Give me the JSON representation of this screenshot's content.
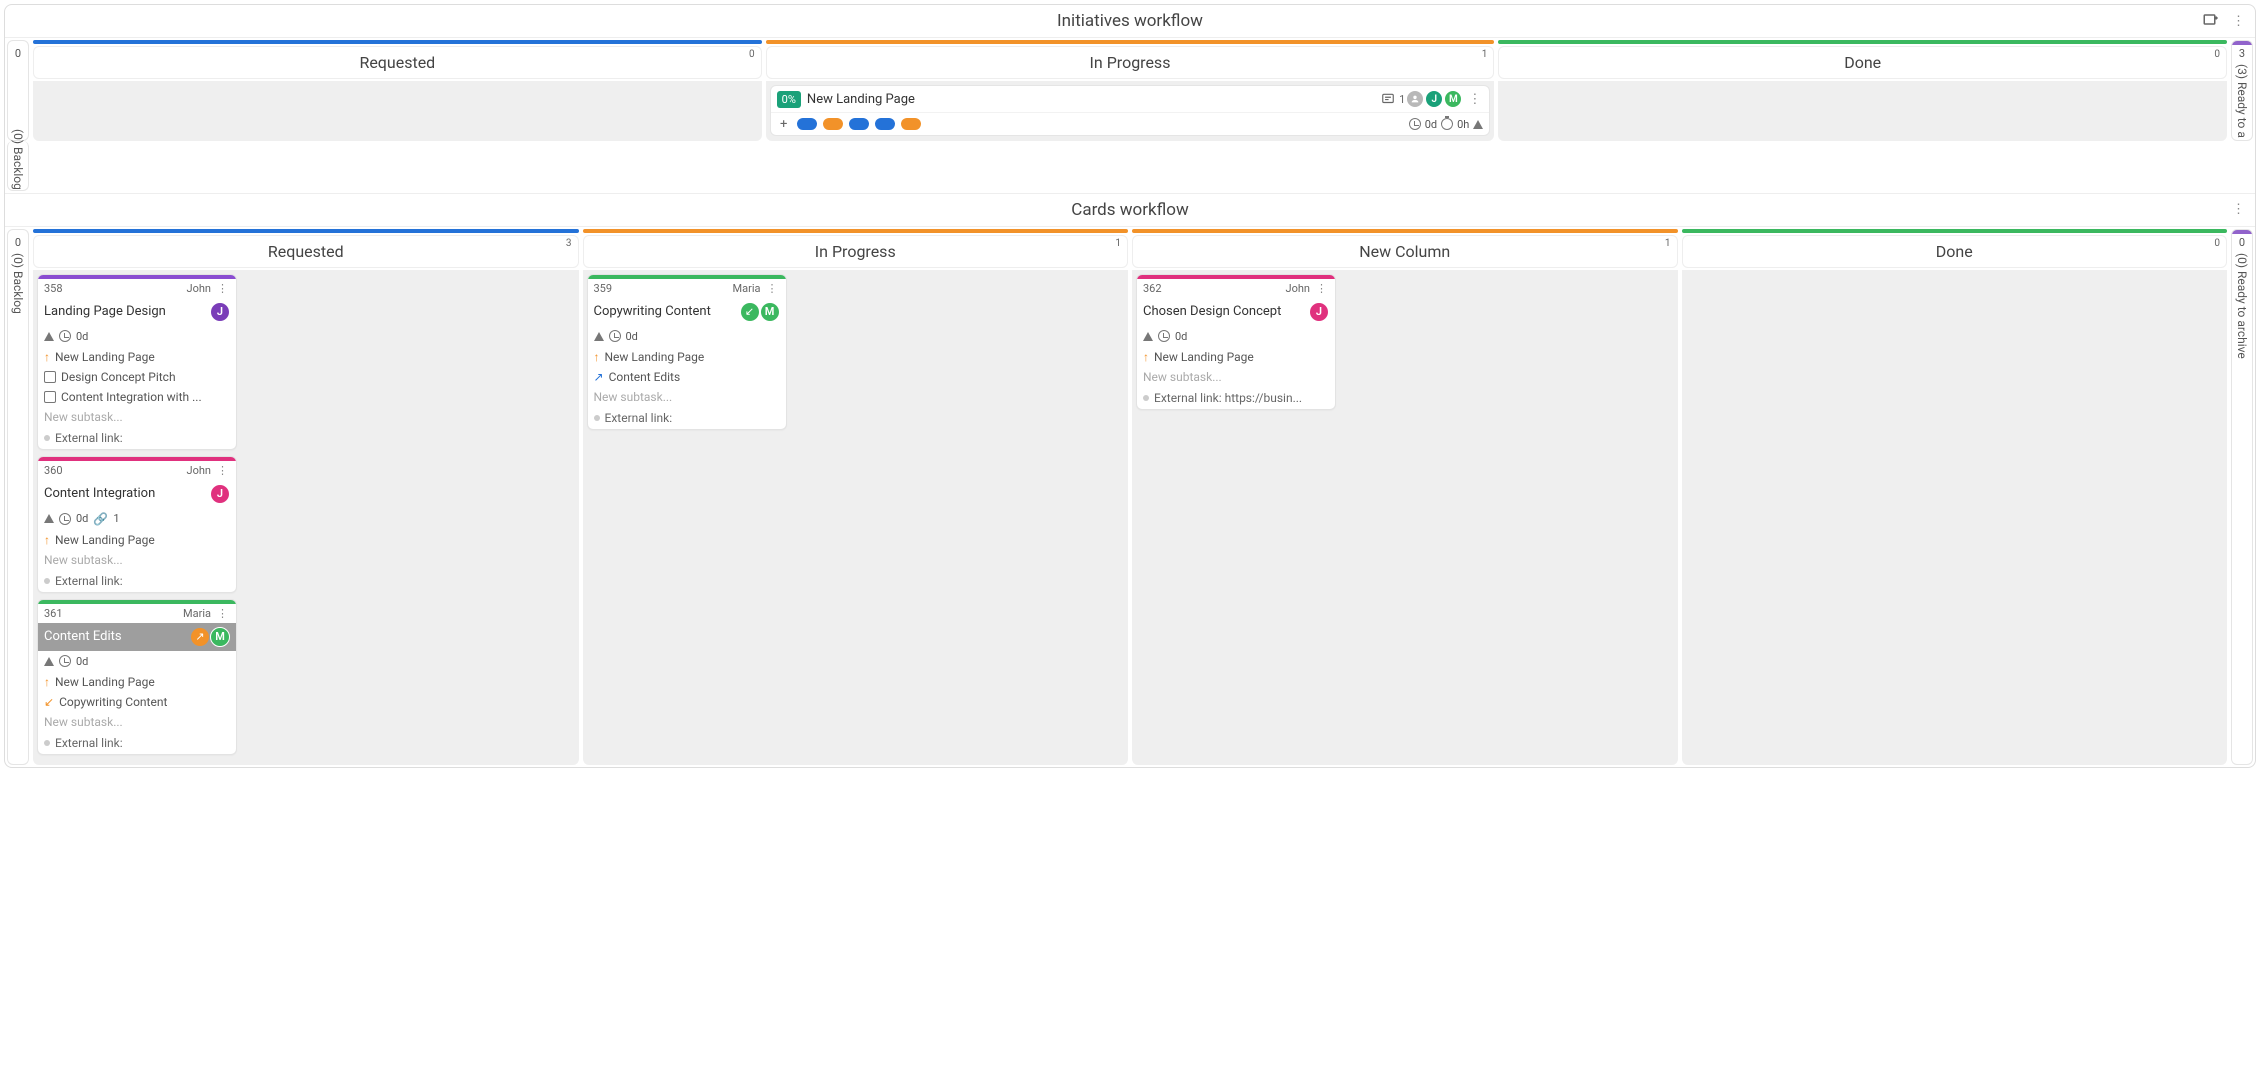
{
  "workflows": {
    "initiatives": {
      "title": "Initiatives workflow",
      "left_lane": {
        "count": "0",
        "label": "(0) Backlog"
      },
      "right_lane": {
        "count": "3",
        "label": "(3) Ready to a"
      },
      "columns": [
        {
          "title": "Requested",
          "count": "0",
          "bar": "blue"
        },
        {
          "title": "In Progress",
          "count": "1",
          "bar": "orange"
        },
        {
          "title": "Done",
          "count": "0",
          "bar": "green"
        }
      ],
      "card": {
        "pct": "0%",
        "title": "New Landing Page",
        "desc_count": "1",
        "days": "0d",
        "hours": "0h"
      }
    },
    "cards": {
      "title": "Cards workflow",
      "left_lane": {
        "count": "0",
        "label": "(0) Backlog"
      },
      "right_lane": {
        "count": "0",
        "label": "(0) Ready to archive"
      },
      "columns": [
        {
          "title": "Requested",
          "count": "3",
          "bar": "blue"
        },
        {
          "title": "In Progress",
          "count": "1",
          "bar": "orange"
        },
        {
          "title": "New Column",
          "count": "1",
          "bar": "orange"
        },
        {
          "title": "Done",
          "count": "0",
          "bar": "green"
        }
      ]
    }
  },
  "cards": {
    "c358": {
      "id": "358",
      "owner": "John",
      "title": "Landing Page Design",
      "days": "0d",
      "parent": "New Landing Page",
      "subs": [
        "Design Concept Pitch",
        "Content Integration with ..."
      ],
      "new_subtask": "New subtask...",
      "ext": "External link:"
    },
    "c360": {
      "id": "360",
      "owner": "John",
      "title": "Content Integration",
      "days": "0d",
      "attach": "1",
      "parent": "New Landing Page",
      "new_subtask": "New subtask...",
      "ext": "External link:"
    },
    "c361": {
      "id": "361",
      "owner": "Maria",
      "title": "Content Edits",
      "days": "0d",
      "parent": "New Landing Page",
      "parent2": "Copywriting Content",
      "new_subtask": "New subtask...",
      "ext": "External link:"
    },
    "c359": {
      "id": "359",
      "owner": "Maria",
      "title": "Copywriting Content",
      "days": "0d",
      "parent": "New Landing Page",
      "child": "Content Edits",
      "new_subtask": "New subtask...",
      "ext": "External link:"
    },
    "c362": {
      "id": "362",
      "owner": "John",
      "title": "Chosen Design Concept",
      "days": "0d",
      "parent": "New Landing Page",
      "new_subtask": "New subtask...",
      "ext": "External link: https://busin..."
    }
  }
}
